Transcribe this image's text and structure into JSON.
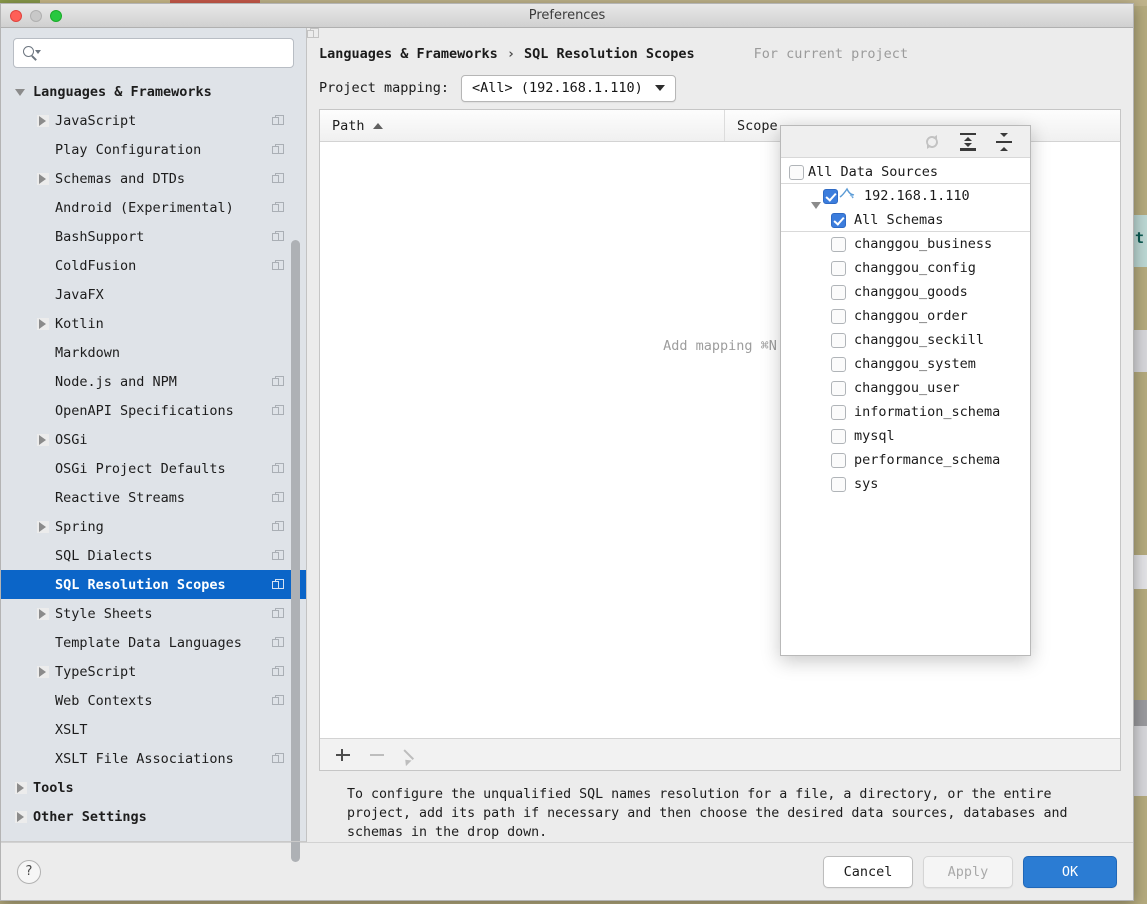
{
  "window": {
    "title": "Preferences",
    "traffic_lights": [
      "close-button",
      "minimize-button",
      "zoom-button"
    ]
  },
  "sidebar": {
    "search": {
      "value": "",
      "placeholder": ""
    },
    "items": [
      {
        "label": "Languages & Frameworks",
        "level": 0,
        "arrow": "down",
        "copy": false,
        "selected": false
      },
      {
        "label": "JavaScript",
        "level": 1,
        "arrow": "right",
        "copy": true,
        "selected": false
      },
      {
        "label": "Play Configuration",
        "level": 1,
        "arrow": "none",
        "copy": true,
        "selected": false
      },
      {
        "label": "Schemas and DTDs",
        "level": 1,
        "arrow": "right",
        "copy": true,
        "selected": false
      },
      {
        "label": "Android (Experimental)",
        "level": 1,
        "arrow": "none",
        "copy": true,
        "selected": false
      },
      {
        "label": "BashSupport",
        "level": 1,
        "arrow": "none",
        "copy": true,
        "selected": false
      },
      {
        "label": "ColdFusion",
        "level": 1,
        "arrow": "none",
        "copy": true,
        "selected": false
      },
      {
        "label": "JavaFX",
        "level": 1,
        "arrow": "none",
        "copy": false,
        "selected": false
      },
      {
        "label": "Kotlin",
        "level": 1,
        "arrow": "right",
        "copy": false,
        "selected": false
      },
      {
        "label": "Markdown",
        "level": 1,
        "arrow": "none",
        "copy": false,
        "selected": false
      },
      {
        "label": "Node.js and NPM",
        "level": 1,
        "arrow": "none",
        "copy": true,
        "selected": false
      },
      {
        "label": "OpenAPI Specifications",
        "level": 1,
        "arrow": "none",
        "copy": true,
        "selected": false
      },
      {
        "label": "OSGi",
        "level": 1,
        "arrow": "right",
        "copy": false,
        "selected": false
      },
      {
        "label": "OSGi Project Defaults",
        "level": 1,
        "arrow": "none",
        "copy": true,
        "selected": false
      },
      {
        "label": "Reactive Streams",
        "level": 1,
        "arrow": "none",
        "copy": true,
        "selected": false
      },
      {
        "label": "Spring",
        "level": 1,
        "arrow": "right",
        "copy": true,
        "selected": false
      },
      {
        "label": "SQL Dialects",
        "level": 1,
        "arrow": "none",
        "copy": true,
        "selected": false
      },
      {
        "label": "SQL Resolution Scopes",
        "level": 1,
        "arrow": "none",
        "copy": true,
        "selected": true
      },
      {
        "label": "Style Sheets",
        "level": 1,
        "arrow": "right",
        "copy": true,
        "selected": false
      },
      {
        "label": "Template Data Languages",
        "level": 1,
        "arrow": "none",
        "copy": true,
        "selected": false
      },
      {
        "label": "TypeScript",
        "level": 1,
        "arrow": "right",
        "copy": true,
        "selected": false
      },
      {
        "label": "Web Contexts",
        "level": 1,
        "arrow": "none",
        "copy": true,
        "selected": false
      },
      {
        "label": "XSLT",
        "level": 1,
        "arrow": "none",
        "copy": false,
        "selected": false
      },
      {
        "label": "XSLT File Associations",
        "level": 1,
        "arrow": "none",
        "copy": true,
        "selected": false
      },
      {
        "label": "Tools",
        "level": 0,
        "arrow": "right",
        "copy": false,
        "selected": false
      },
      {
        "label": "Other Settings",
        "level": 0,
        "arrow": "right",
        "copy": false,
        "selected": false
      }
    ],
    "selected_color": "#0b65c8"
  },
  "main": {
    "breadcrumb": {
      "root": "Languages & Frameworks",
      "separator": "›",
      "current": "SQL Resolution Scopes"
    },
    "scope_note": "For current project",
    "mapping": {
      "label": "Project mapping:",
      "combo_value": "<All> (192.168.1.110)"
    },
    "table": {
      "columns": [
        "Path",
        "Scope"
      ],
      "sort_column": "Path",
      "sort_direction": "ascending",
      "rows": [],
      "empty_hint": "Add mapping ⌘N"
    },
    "table_toolbar": {
      "add": "add-row",
      "remove": "remove-row",
      "edit": "edit-row"
    },
    "description": "To configure the unqualified SQL names resolution for a file, a directory, or the entire project, add its path if necessary and then choose the desired data sources, databases and schemas in the drop down."
  },
  "popup": {
    "toolbar_icons": [
      "refresh-icon",
      "expand-all-icon",
      "collapse-all-icon"
    ],
    "rows": [
      {
        "label": "All Data Sources",
        "checked": false,
        "level": 1,
        "arrow": "none",
        "icon": "none",
        "sep": true
      },
      {
        "label": "192.168.1.110",
        "checked": true,
        "level": 0,
        "arrow": "down",
        "icon": "mysql",
        "sep": false
      },
      {
        "label": "All Schemas",
        "checked": true,
        "level": 2,
        "arrow": "none",
        "icon": "none",
        "sep": true
      },
      {
        "label": "changgou_business",
        "checked": false,
        "level": 3,
        "arrow": "none",
        "icon": "none",
        "sep": false
      },
      {
        "label": "changgou_config",
        "checked": false,
        "level": 3,
        "arrow": "none",
        "icon": "none",
        "sep": false
      },
      {
        "label": "changgou_goods",
        "checked": false,
        "level": 3,
        "arrow": "none",
        "icon": "none",
        "sep": false
      },
      {
        "label": "changgou_order",
        "checked": false,
        "level": 3,
        "arrow": "none",
        "icon": "none",
        "sep": false
      },
      {
        "label": "changgou_seckill",
        "checked": false,
        "level": 3,
        "arrow": "none",
        "icon": "none",
        "sep": false
      },
      {
        "label": "changgou_system",
        "checked": false,
        "level": 3,
        "arrow": "none",
        "icon": "none",
        "sep": false
      },
      {
        "label": "changgou_user",
        "checked": false,
        "level": 3,
        "arrow": "none",
        "icon": "none",
        "sep": false
      },
      {
        "label": "information_schema",
        "checked": false,
        "level": 3,
        "arrow": "none",
        "icon": "none",
        "sep": false
      },
      {
        "label": "mysql",
        "checked": false,
        "level": 3,
        "arrow": "none",
        "icon": "none",
        "sep": false
      },
      {
        "label": "performance_schema",
        "checked": false,
        "level": 3,
        "arrow": "none",
        "icon": "none",
        "sep": false
      },
      {
        "label": "sys",
        "checked": false,
        "level": 3,
        "arrow": "none",
        "icon": "none",
        "sep": false
      }
    ],
    "checkbox_color": "#3c7ddd"
  },
  "footer": {
    "help": "?",
    "cancel": "Cancel",
    "apply": "Apply",
    "apply_enabled": false,
    "ok": "OK",
    "ok_color": "#2b7cd3"
  },
  "background": {
    "editor_tab_letter": "t"
  }
}
